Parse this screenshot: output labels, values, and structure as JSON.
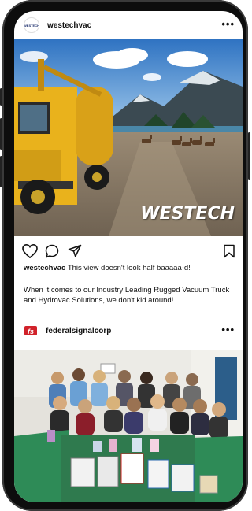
{
  "post1": {
    "handle": "westechvac",
    "avatar_text": "WESTECH",
    "image_logo": "WESTECH",
    "more_label": "•••",
    "caption_handle": "westechvac",
    "caption_text": "This view doesn't look half baaaaa-d!",
    "body_text": "When it comes to our Industry Leading Rugged Vacuum Truck and Hydrovac Solutions, we don't kid around!"
  },
  "post2": {
    "handle": "federalsignalcorp",
    "avatar_text": "fs",
    "more_label": "•••"
  },
  "icons": [
    "heart-icon",
    "comment-icon",
    "share-icon",
    "bookmark-icon"
  ],
  "colors": {
    "truck_yellow": "#e9b21c",
    "brand_red": "#d1222a",
    "table_green": "#2e8b57",
    "sky_blue": "#3d7fc4"
  }
}
